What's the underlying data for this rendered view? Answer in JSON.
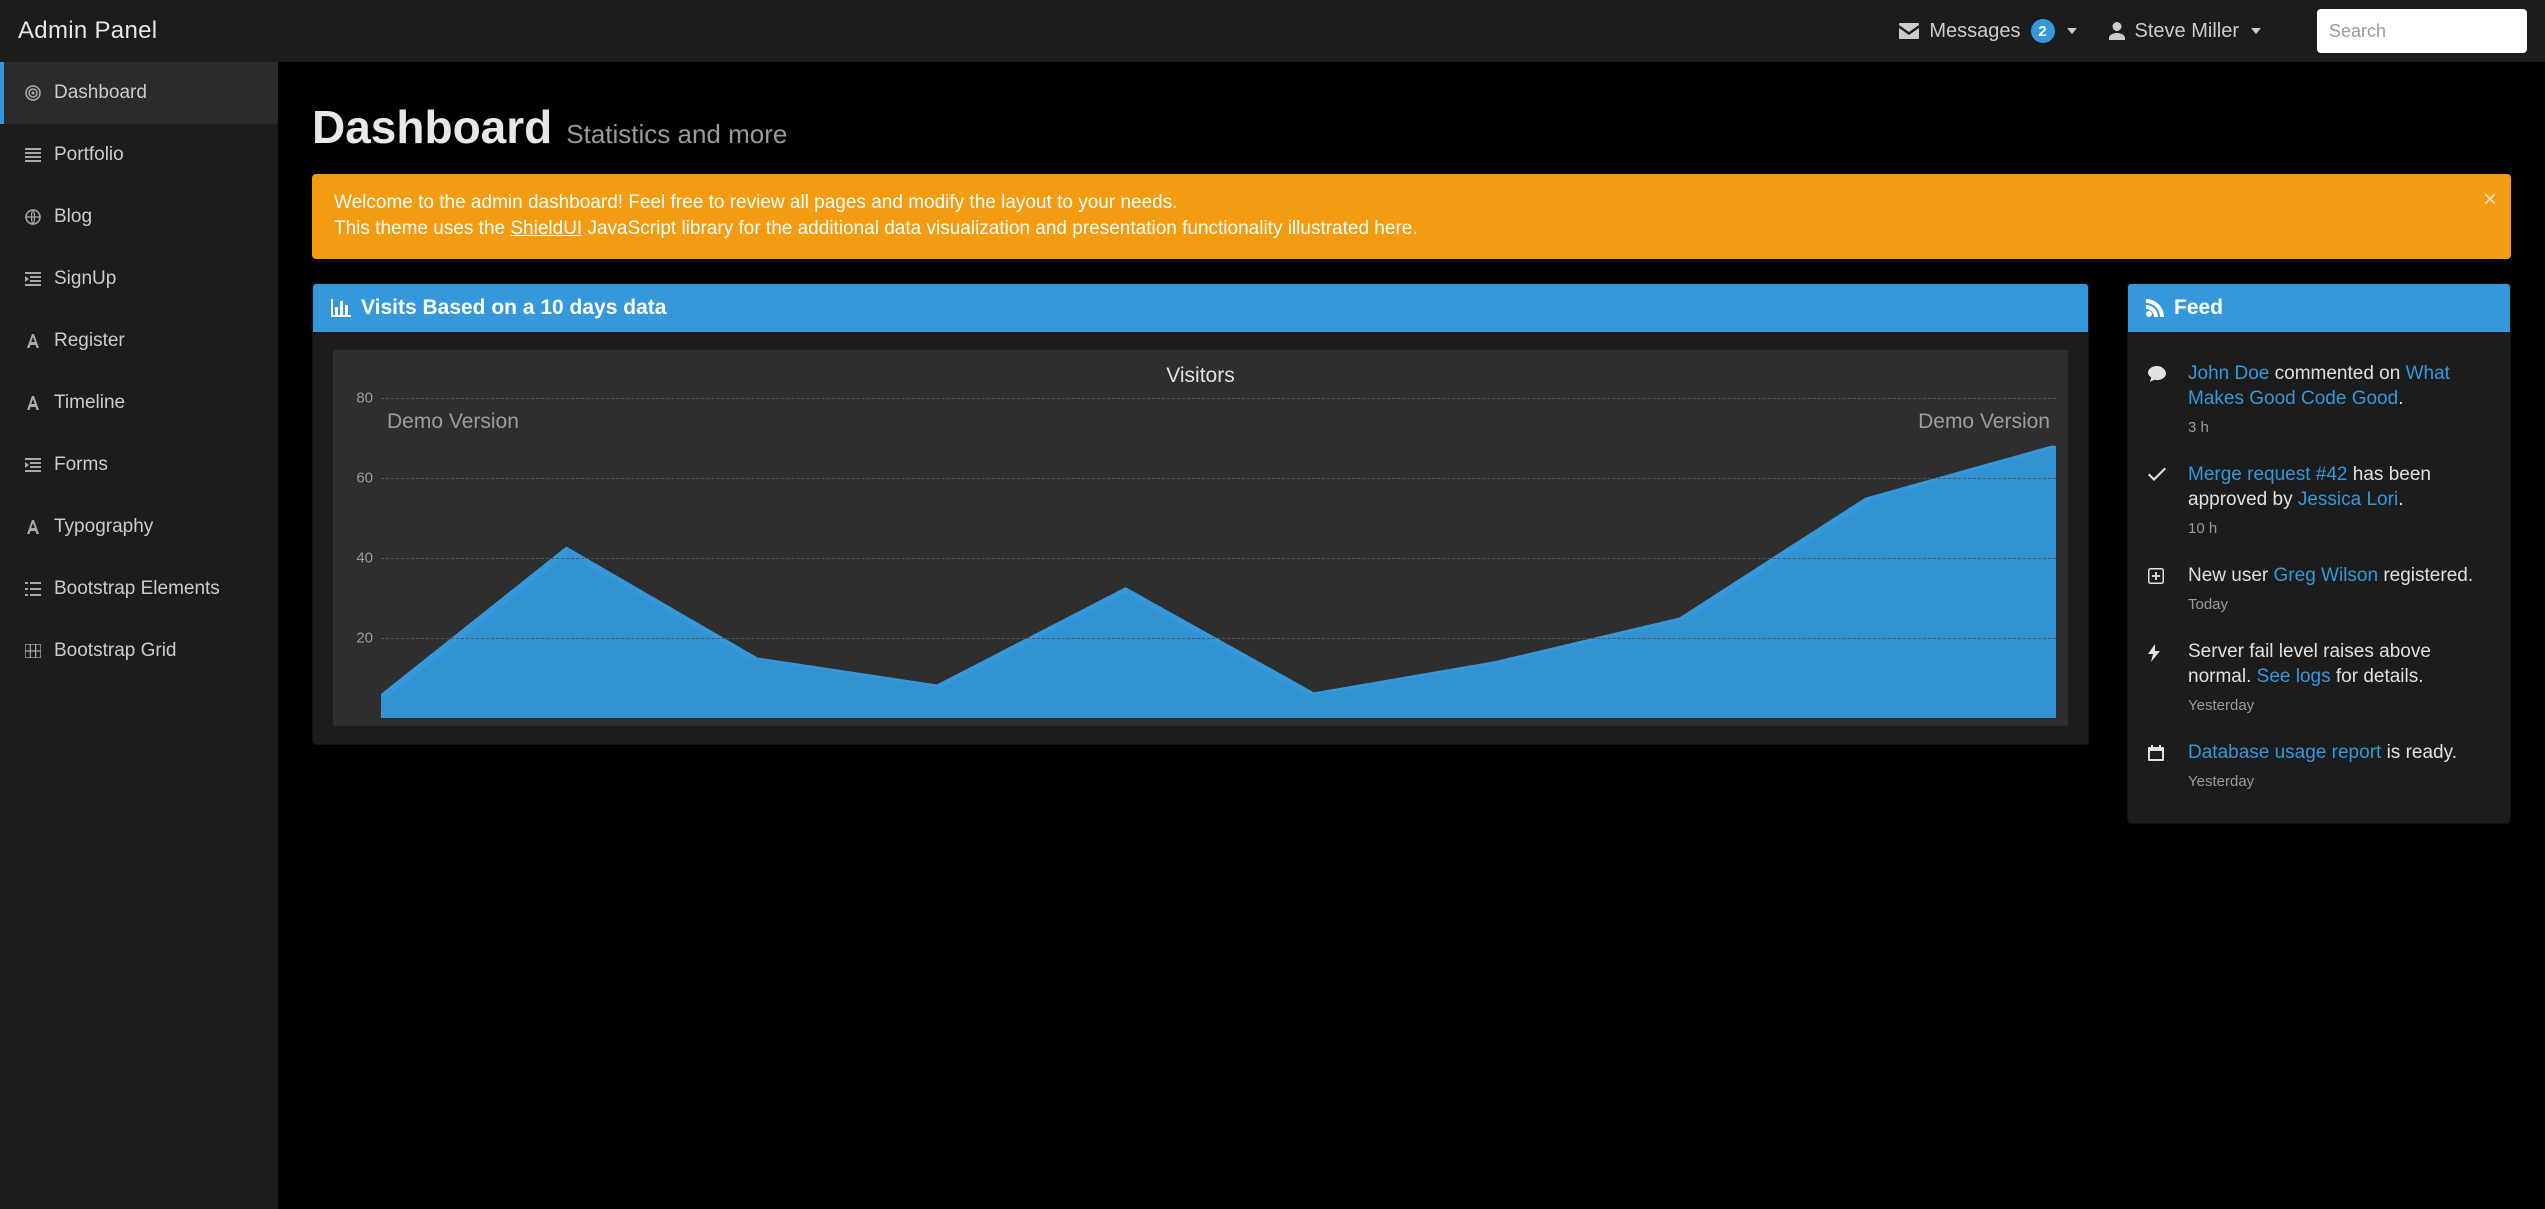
{
  "brand": "Admin Panel",
  "navbar": {
    "messages_label": "Messages",
    "messages_count": "2",
    "user_name": "Steve Miller",
    "search_placeholder": "Search"
  },
  "sidebar": {
    "items": [
      {
        "label": "Dashboard",
        "icon": "bullseye",
        "active": true
      },
      {
        "label": "Portfolio",
        "icon": "list-bars",
        "active": false
      },
      {
        "label": "Blog",
        "icon": "globe",
        "active": false
      },
      {
        "label": "SignUp",
        "icon": "indent",
        "active": false
      },
      {
        "label": "Register",
        "icon": "font",
        "active": false
      },
      {
        "label": "Timeline",
        "icon": "font",
        "active": false
      },
      {
        "label": "Forms",
        "icon": "indent",
        "active": false
      },
      {
        "label": "Typography",
        "icon": "font",
        "active": false
      },
      {
        "label": "Bootstrap Elements",
        "icon": "list",
        "active": false
      },
      {
        "label": "Bootstrap Grid",
        "icon": "grid",
        "active": false
      }
    ]
  },
  "page": {
    "title": "Dashboard",
    "subtitle": "Statistics and more"
  },
  "alert": {
    "line1_pre": "Welcome to the admin dashboard! Feel free to review all pages and modify the layout to your needs.",
    "line2_pre": "This theme uses the ",
    "link_text": "ShieldUI",
    "line2_post": " JavaScript library for the additional data visualization and presentation functionality illustrated here."
  },
  "chart_panel": {
    "heading": "Visits Based on a 10 days data"
  },
  "chart_data": {
    "type": "area",
    "title": "Visitors",
    "xlabel": "",
    "ylabel": "",
    "ylim": [
      0,
      80
    ],
    "y_ticks": [
      20,
      40,
      60,
      80
    ],
    "x": [
      1,
      2,
      3,
      4,
      5,
      6,
      7,
      8,
      9,
      10
    ],
    "values": [
      5,
      42,
      15,
      8,
      32,
      6,
      14,
      25,
      55,
      68
    ],
    "watermark_left": "Demo Version",
    "watermark_right": "Demo Version",
    "series_color": "#3498db"
  },
  "feed_panel": {
    "heading": "Feed",
    "items": [
      {
        "icon": "comment",
        "fragments": [
          {
            "t": "John Doe",
            "link": true
          },
          {
            "t": " commented on ",
            "link": false
          },
          {
            "t": "What Makes Good Code Good",
            "link": true
          },
          {
            "t": ".",
            "link": false
          }
        ],
        "time": "3 h"
      },
      {
        "icon": "check",
        "fragments": [
          {
            "t": "Merge request #42",
            "link": true
          },
          {
            "t": " has been approved by ",
            "link": false
          },
          {
            "t": "Jessica Lori",
            "link": true
          },
          {
            "t": ".",
            "link": false
          }
        ],
        "time": "10 h"
      },
      {
        "icon": "plus-square",
        "fragments": [
          {
            "t": "New user ",
            "link": false
          },
          {
            "t": "Greg Wilson",
            "link": true
          },
          {
            "t": " registered.",
            "link": false
          }
        ],
        "time": "Today"
      },
      {
        "icon": "bolt",
        "fragments": [
          {
            "t": "Server fail level raises above normal. ",
            "link": false
          },
          {
            "t": "See logs",
            "link": true
          },
          {
            "t": " for details.",
            "link": false
          }
        ],
        "time": "Yesterday"
      },
      {
        "icon": "calendar",
        "fragments": [
          {
            "t": "Database usage report",
            "link": true
          },
          {
            "t": " is ready.",
            "link": false
          }
        ],
        "time": "Yesterday"
      }
    ]
  }
}
